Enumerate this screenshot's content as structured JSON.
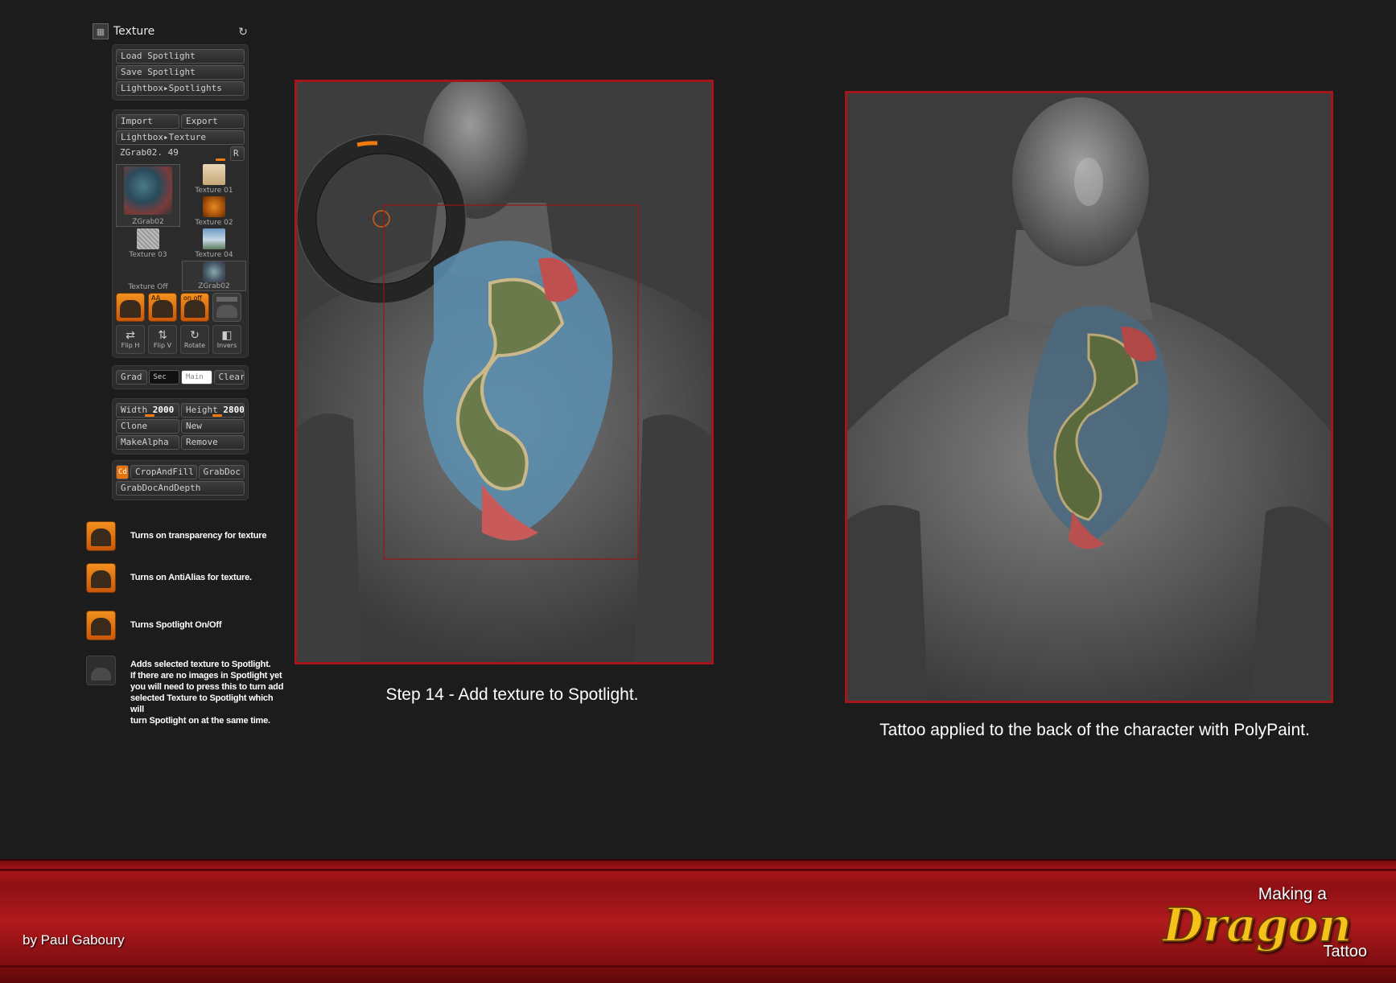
{
  "palette": {
    "title": "Texture",
    "spotlight_buttons": [
      "Load Spotlight",
      "Save Spotlight",
      "Lightbox▸Spotlights"
    ],
    "import_label": "Import",
    "export_label": "Export",
    "lightbox_texture": "Lightbox▸Texture",
    "current_texture": "ZGrab02. 49",
    "r_label": "R",
    "thumbs": {
      "main": "ZGrab02",
      "t1": "Texture 01",
      "t2": "Texture 02",
      "t3": "Texture 03",
      "t4": "Texture 04",
      "off": "Texture Off",
      "z2": "ZGrab02"
    },
    "orange_labels": {
      "aa": "AA",
      "onoff": "on off"
    },
    "small_buttons": [
      "Flip H",
      "Flip V",
      "Rotate",
      "Invers"
    ],
    "grad": "Grad",
    "sec": "Sec",
    "main": "Main",
    "clear": "Clear",
    "width_label": "Width",
    "width_value": "2000",
    "height_label": "Height",
    "height_value": "2800",
    "clone": "Clone",
    "new": "New",
    "makealpha": "MakeAlpha",
    "remove": "Remove",
    "cd": "Cd",
    "cropandfill": "CropAndFill",
    "grabdoc": "GrabDoc",
    "grabdocanddepth": "GrabDocAndDepth"
  },
  "legend": [
    {
      "text": "Turns on transparency for texture"
    },
    {
      "text": "Turns on AntiAlias for texture."
    },
    {
      "text": "Turns Spotlight On/Off"
    },
    {
      "lines": [
        "Adds selected texture to Spotlight.",
        "If there are no images in Spotlight yet",
        "you will need to press this to turn add",
        "selected Texture to Spotlight which will",
        "turn Spotlight on at the same time."
      ]
    }
  ],
  "captions": {
    "left": "Step 14 - Add texture to Spotlight.",
    "right": "Tattoo applied to the back of the character with PolyPaint."
  },
  "footer": {
    "byline": "by Paul Gaboury",
    "logo_making": "Making a",
    "logo_dragon": "Dragon",
    "logo_tattoo": "Tattoo"
  },
  "colors": {
    "frame_red": "#a4161a",
    "accent_orange": "#f07a10",
    "footer_red": "#a81619",
    "logo_gold": "#f4c21a"
  }
}
